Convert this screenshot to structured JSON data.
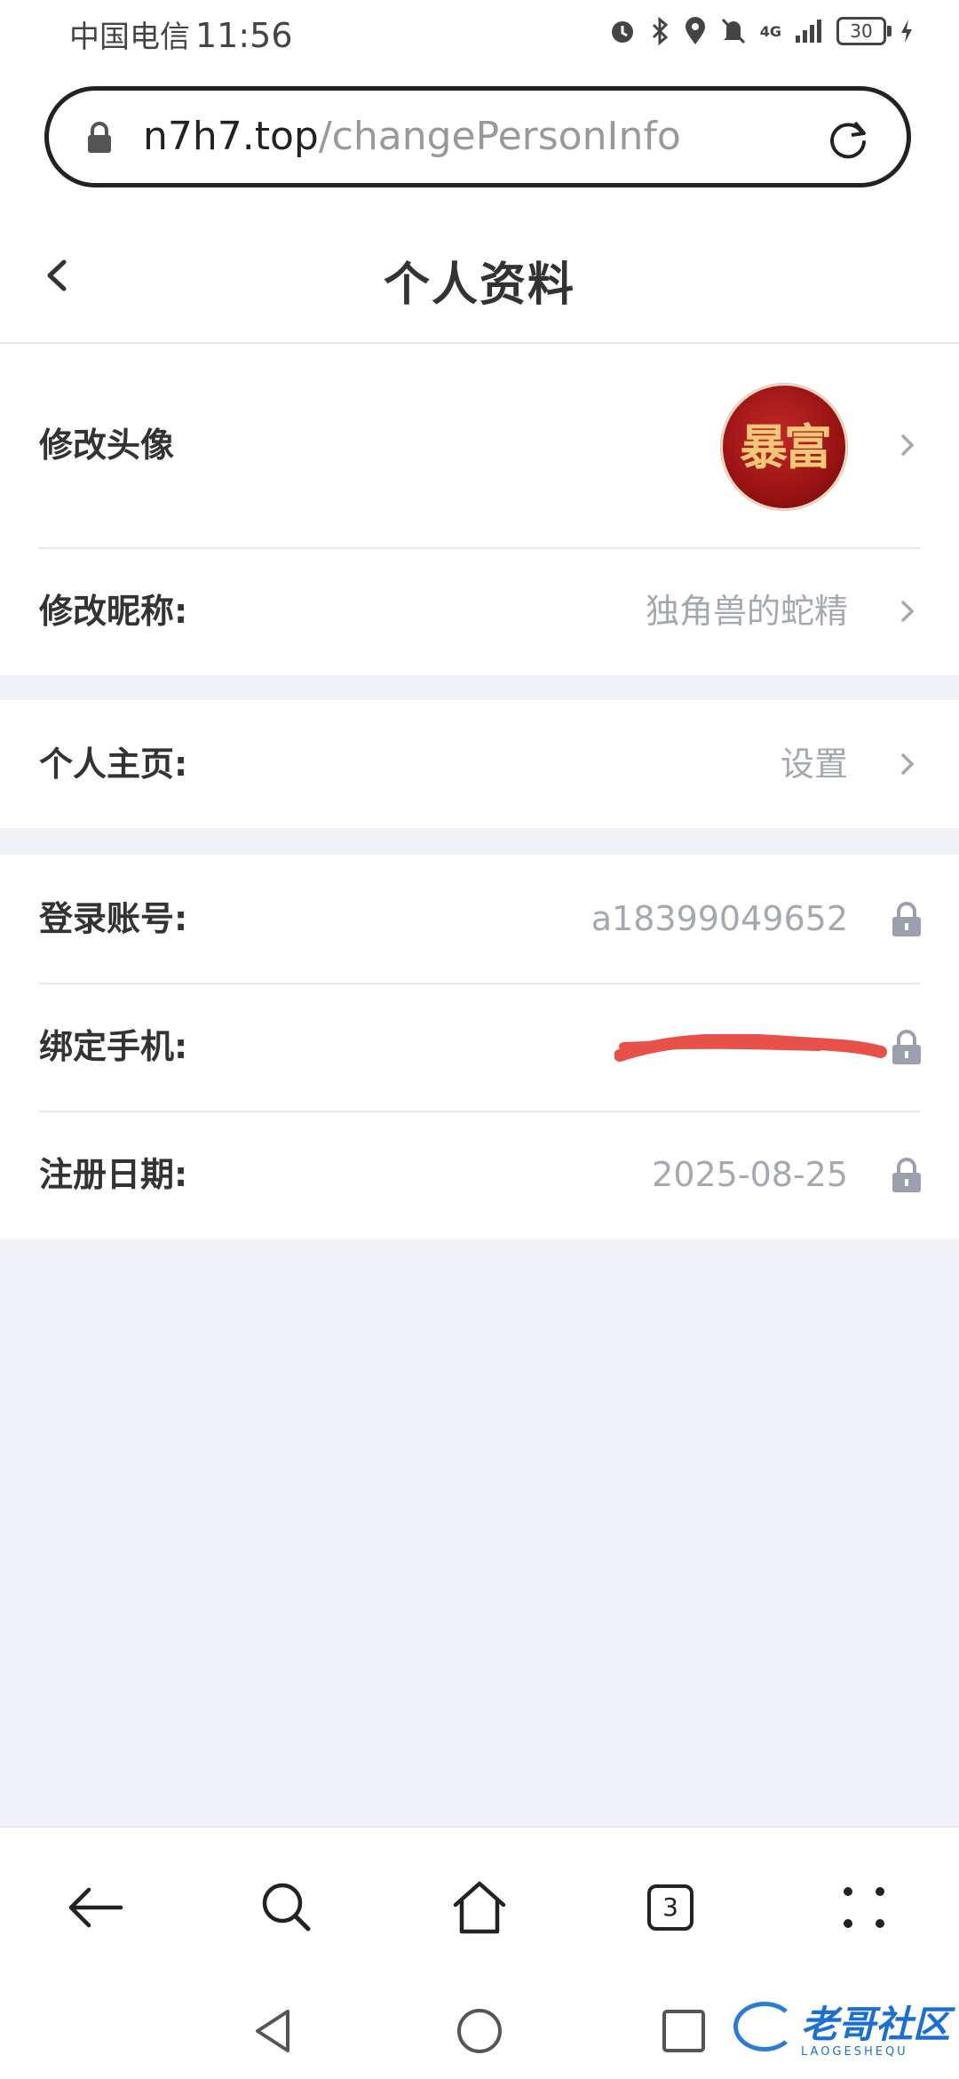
{
  "status_bar": {
    "carrier": "中国电信",
    "time": "11:56",
    "network": "4G",
    "battery": "30"
  },
  "browser": {
    "url_domain": "n7h7.top",
    "url_path": "/changePersonInfo",
    "tabs_count": "3"
  },
  "header": {
    "title": "个人资料"
  },
  "profile": {
    "avatar_label": "修改头像",
    "avatar_text": "暴富",
    "nickname_label": "修改昵称:",
    "nickname_value": "独角兽的蛇精",
    "homepage_label": "个人主页:",
    "homepage_value": "设置",
    "account_label": "登录账号:",
    "account_value": "a18399049652",
    "phone_label": "绑定手机:",
    "regdate_label": "注册日期:",
    "regdate_value": "2025-08-25"
  },
  "watermark": {
    "text": "老哥社区",
    "subtext": "LAOGESHEQU"
  },
  "colors": {
    "accent_red": "#e8504a",
    "value_gray": "#a4a8b0",
    "page_bg": "#f0f2f7"
  }
}
